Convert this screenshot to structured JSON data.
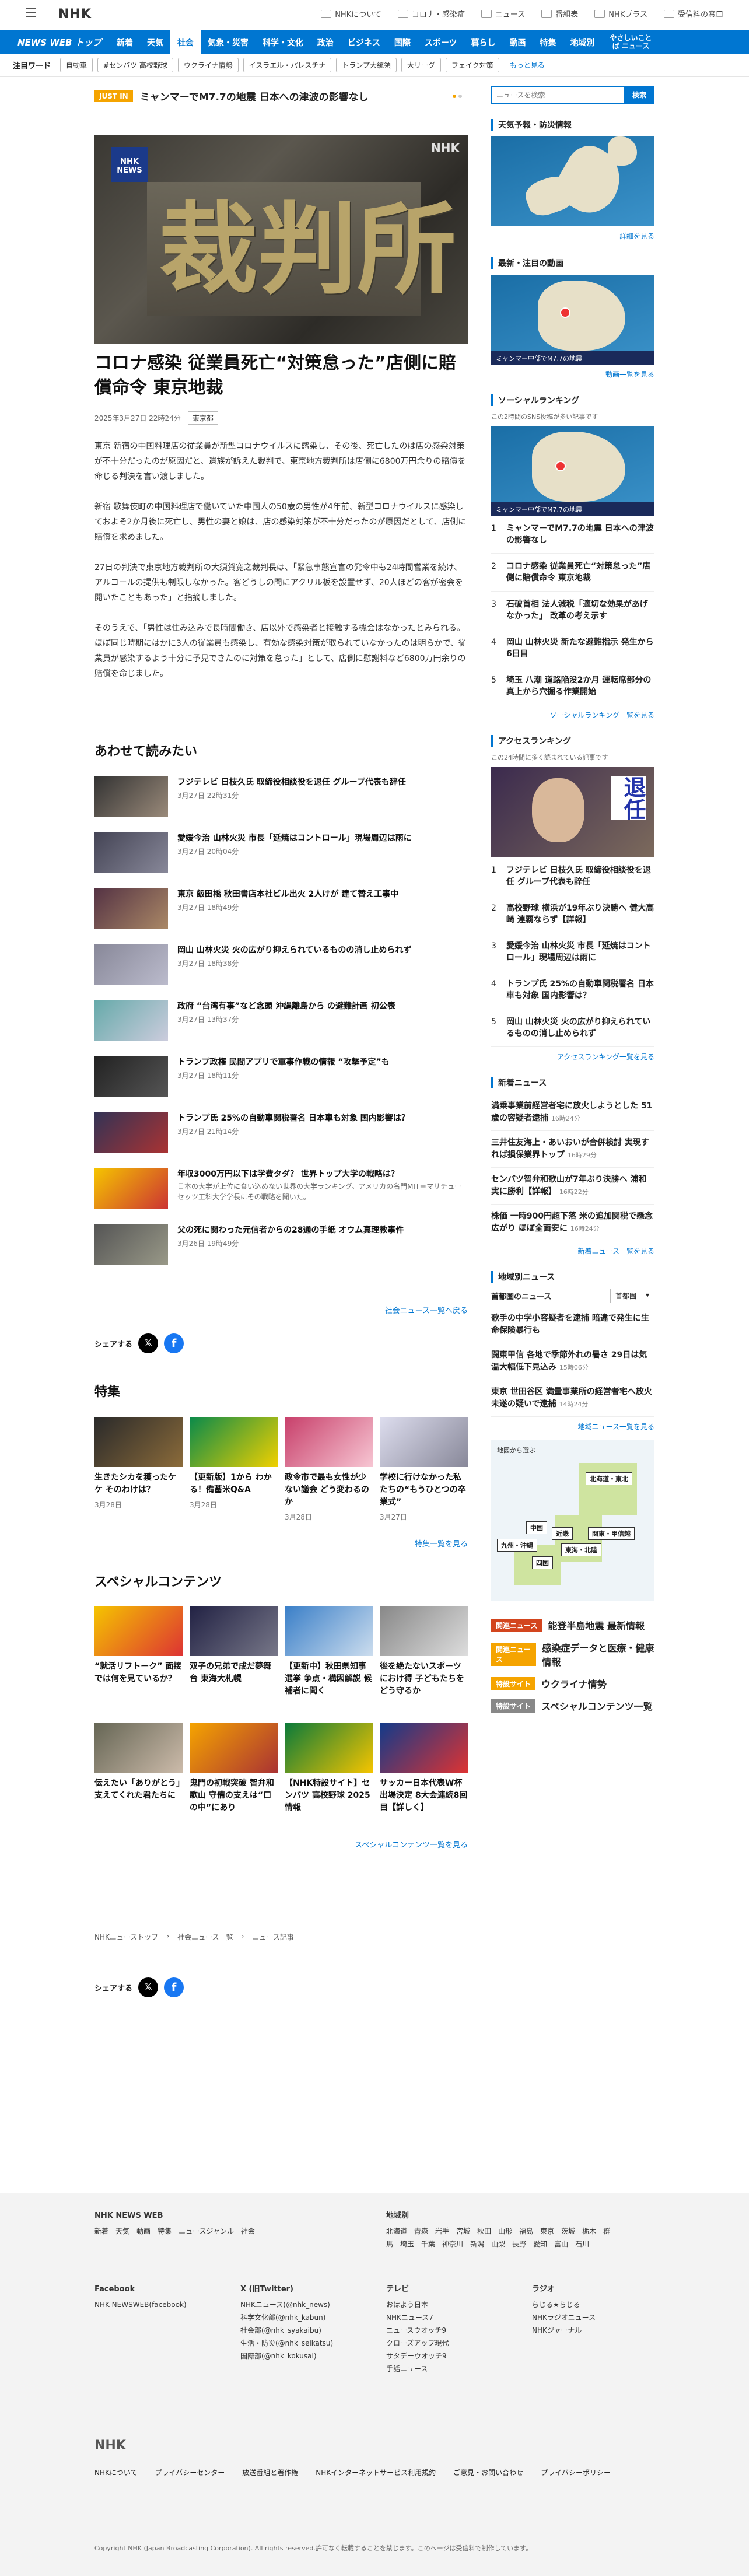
{
  "header": {
    "logo": "NHK",
    "links": [
      "NHKについて",
      "コロナ・感染症",
      "ニュース",
      "番組表",
      "NHKプラス",
      "受信料の窓口"
    ]
  },
  "nav": {
    "brand": "NEWS WEB トップ",
    "items": [
      "新着",
      "天気",
      "社会",
      "気象・災害",
      "科学・文化",
      "政治",
      "ビジネス",
      "国際",
      "スポーツ",
      "暮らし",
      "動画",
      "特集",
      "地域別"
    ],
    "last": "やさしいことば ニュース",
    "active": "社会"
  },
  "keywords": {
    "label": "注目ワード",
    "tags": [
      "自動車",
      "#センバツ 高校野球",
      "ウクライナ情勢",
      "イスラエル・パレスチナ",
      "トランプ大統領",
      "大リーグ",
      "フェイク対策"
    ],
    "more": "もっと見る"
  },
  "breaking": {
    "badge": "JUST IN",
    "text": "ミャンマーでM7.7の地震 日本への津波の影響なし"
  },
  "article": {
    "hero_label": "NHK NEWS",
    "hero_text": "裁判所",
    "watermark": "NHK",
    "title": "コロナ感染 従業員死亡“対策怠った”店側に賠償命令 東京地裁",
    "date": "2025年3月27日 22時24分",
    "category": "東京都",
    "paragraphs": [
      "東京 新宿の中国料理店の従業員が新型コロナウイルスに感染し、その後、死亡したのは店の感染対策が不十分だったのが原因だと、遺族が訴えた裁判で、東京地方裁判所は店側に6800万円余りの賠償を命じる判決を言い渡しました。",
      "新宿 歌舞伎町の中国料理店で働いていた中国人の50歳の男性が4年前、新型コロナウイルスに感染しておよそ2か月後に死亡し、男性の妻と娘は、店の感染対策が不十分だったのが原因だとして、店側に賠償を求めました。",
      "27日の判決で東京地方裁判所の大須賀寛之裁判長は、「緊急事態宣言の発令中も24時間営業を続け、アルコールの提供も制限しなかった。客どうしの間にアクリル板を設置せず、20人ほどの客が密会を開いたこともあった」と指摘しました。",
      "そのうえで、「男性は住み込みで長時間働き、店以外で感染者と接触する機会はなかったとみられる。ほぼ同じ時期にはかに3人の従業員も感染し、有効な感染対策が取られていなかったのは明らかで、従業員が感染するよう十分に予見できたのに対策を怠った」として、店側に慰謝料など6800万円余りの賠償を命じました。"
    ]
  },
  "related": {
    "heading": "あわせて読みたい",
    "items": [
      {
        "title": "フジテレビ 日枝久氏 取締役相談役を退任 グループ代表も辞任",
        "date": "3月27日 22時31分",
        "sub": ""
      },
      {
        "title": "愛媛今治 山林火災 市長「延焼はコントロール」現場周辺は雨に",
        "date": "3月27日 20時04分",
        "sub": ""
      },
      {
        "title": "東京 飯田橋 秋田書店本社ビル出火 2人けが 建て替え工事中",
        "date": "3月27日 18時49分",
        "sub": ""
      },
      {
        "title": "岡山 山林火災 火の広がり抑えられているものの消し止められず",
        "date": "3月27日 18時38分",
        "sub": ""
      },
      {
        "title": "政府 “台湾有事”など念頭 沖縄離島から の避難計画 初公表",
        "date": "3月27日 13時37分",
        "sub": ""
      },
      {
        "title": "トランプ政権 民間アプリで軍事作戦の情報 “攻撃予定”も",
        "date": "3月27日 18時11分",
        "sub": ""
      },
      {
        "title": "トランプ氏 25%の自動車関税署名 日本車も対象 国内影響は？",
        "date": "3月27日 21時14分",
        "sub": ""
      },
      {
        "title": "年収3000万円以下は学費タダ？ 世界トップ大学の戦略は？",
        "date": "",
        "sub": "日本の大学が上位に食い込めない世界の大学ランキング。アメリカの名門MIT＝マサチューセッツ工科大学学長にその戦略を聞いた。"
      },
      {
        "title": "父の死に関わった元信者からの28通の手紙 オウム真理教事件",
        "date": "3月26日 19時49分",
        "sub": ""
      }
    ],
    "more": "社会ニュース一覧へ戻る"
  },
  "share_label": "シェアする",
  "features": {
    "heading": "特集",
    "items": [
      {
        "title": "生きたシカを獲ったケケ そのわけは？",
        "date": "3月28日"
      },
      {
        "title": "【更新版】1から わかる！備蓄米Q&A",
        "date": "3月28日"
      },
      {
        "title": "政令市で最も女性が少ない議会 どう変わるのか",
        "date": "3月28日"
      },
      {
        "title": "学校に行けなかった私たちの“もうひとつの卒業式”",
        "date": "3月27日"
      }
    ],
    "more": "特集一覧を見る"
  },
  "special": {
    "heading": "スペシャルコンテンツ",
    "items": [
      {
        "title": "“就活リフトーク” 面接では何を見ているか？"
      },
      {
        "title": "双子の兄弟で成だ夢舞台 東海大札幌"
      },
      {
        "title": "【更新中】秋田県知事選挙 争点・構図解説 候補者に聞く"
      },
      {
        "title": "後を絶たないスポーツにおけ得 子どもたちをどう守るか"
      },
      {
        "title": "伝えたい「ありがとう」支えてくれた君たちに"
      },
      {
        "title": "鬼門の初戦突破 智弁和歌山 守備の支えは“口の中”にあり"
      },
      {
        "title": "【NHK特設サイト】センバツ 高校野球 2025 情報"
      },
      {
        "title": "サッカー日本代表W杯出場決定 8大会連続8回目【詳しく】"
      }
    ],
    "more": "スペシャルコンテンツ一覧を見る"
  },
  "breadcrumb": [
    "NHKニューストップ",
    "社会ニュース一覧",
    "ニュース記事"
  ],
  "sidebar": {
    "search_placeholder": "ニュースを検索",
    "search_btn": "検索",
    "weather": {
      "heading": "天気予報・防災情報",
      "more": "詳細を見る"
    },
    "video": {
      "heading": "最新・注目の動画",
      "caption": "ミャンマー中部でM7.7の地震",
      "more": "動画一覧を見る"
    },
    "social": {
      "heading": "ソーシャルランキング",
      "note": "この2時間のSNS投稿が多い記事です",
      "items": [
        "ミャンマーでM7.7の地震 日本への津波の影響なし",
        "コロナ感染 従業員死亡“対策怠った”店側に賠償命令 東京地裁",
        "石破首相 法人減税「適切な効果があげなかった」 改革の考え示す",
        "岡山 山林火災 新たな避難指示 発生から6日目",
        "埼玉 八潮 道路陥没2か月 運転席部分の真上から穴掘る作業開始"
      ],
      "more": "ソーシャルランキング一覧を見る"
    },
    "access": {
      "heading": "アクセスランキング",
      "note": "この24時間に多く読まれている記事です",
      "banner": "退任",
      "items": [
        "フジテレビ 日枝久氏 取締役相談役を退任 グループ代表も辞任",
        "高校野球 横浜が19年ぶり決勝へ 健大高崎 連覇ならず【詳報】",
        "愛媛今治 山林火災 市長「延焼はコントロール」現場周辺は雨に",
        "トランプ氏 25%の自動車関税署名 日本車も対象 国内影響は？",
        "岡山 山林火災 火の広がり抑えられているものの消し止められず"
      ],
      "more": "アクセスランキング一覧を見る"
    },
    "latest": {
      "heading": "新着ニュース",
      "items": [
        {
          "t": "満乗事業前経営者宅に放火しようとした 51歳の容疑者逮捕",
          "d": "16時24分"
        },
        {
          "t": "三井住友海上・あいおいが合併検討 実現すれば損保業界トップ",
          "d": "16時29分"
        },
        {
          "t": "センバツ智弁和歌山が7年ぶり決勝へ 浦和実に勝利【詳報】",
          "d": "16時22分"
        },
        {
          "t": "株価 一時900円超下落 米の追加関税で懸念広がり ほぼ全面安に",
          "d": "16時24分"
        }
      ],
      "more": "新着ニュース一覧を見る"
    },
    "regional": {
      "heading": "地域別ニュース",
      "region_label": "首都圏のニュース",
      "select": "首都圏",
      "items": [
        {
          "t": "歌手の中学小容疑者を逮捕 暗違で発生に生命保険暴行も",
          "d": ""
        },
        {
          "t": "闘東甲信 各地で季節外れの暑さ 29日は気温大幅低下見込み",
          "d": "15時06分"
        },
        {
          "t": "東京 世田谷区 満量事業所の経営者宅へ放火未遂の疑いで逮捕",
          "d": "14時24分"
        }
      ],
      "more": "地域ニュース一覧を見る",
      "map_title": "地図から選ぶ",
      "areas": [
        "北海道・東北",
        "関東・甲信越",
        "東海・北陸",
        "近畿",
        "中国",
        "四国",
        "九州・沖縄"
      ]
    },
    "promos": [
      {
        "badge": "関連ニュース",
        "text": "能登半島地震 最新情報",
        "color": "#d3451e"
      },
      {
        "badge": "関連ニュース",
        "text": "感染症データと医療・健康情報",
        "color": "#f5a400"
      },
      {
        "badge": "特設サイト",
        "text": "ウクライナ情勢",
        "color": "#f5a400"
      },
      {
        "badge": "特設サイト",
        "text": "スペシャルコンテンツ一覧",
        "color": "#888"
      }
    ]
  },
  "footer": {
    "cols": [
      {
        "h": "NHK NEWS WEB",
        "items": [
          "新着",
          "天気",
          "動画",
          "特集",
          "ニュースジャンル",
          "社会",
          "気象・災害",
          "科学・文化",
          "政治",
          "ビジネス",
          "国際",
          "スポーツ",
          "暮らし",
          "NHK やさしいことばニュース"
        ]
      },
      {
        "h": "地域別",
        "items": [
          "北海道",
          "青森",
          "岩手",
          "宮城",
          "秋田",
          "山形",
          "福島",
          "東京",
          "茨城",
          "栃木",
          "群馬",
          "埼玉",
          "千葉",
          "神奈川",
          "新潟",
          "山梨",
          "長野",
          "愛知",
          "富山",
          "石川",
          "福井",
          "岐阜",
          "静岡",
          "三重",
          "大阪",
          "京都",
          "兵庫",
          "奈良",
          "滋賀",
          "和歌山",
          "鳥取",
          "島根",
          "岡山",
          "広島",
          "山口",
          "徳島",
          "香川",
          "愛媛",
          "高知",
          "福岡",
          "佐賀",
          "長崎",
          "熊本",
          "大分",
          "宮崎",
          "鹿児島",
          "沖縄",
          "全国"
        ]
      }
    ],
    "social": {
      "facebook": [
        "Facebook",
        "NHK NEWSWEB(facebook)"
      ],
      "x": [
        "X (旧Twitter)",
        "NHKニュース(@nhk_news)",
        "科学文化部(@nhk_kabun)",
        "社会部(@nhk_syakaibu)",
        "生活・防災(@nhk_seikatsu)",
        "国際部(@nhk_kokusai)"
      ],
      "tv": [
        "テレビ",
        "おはよう日本",
        "NHKニュース7",
        "ニュースウオッチ9",
        "クローズアップ現代",
        "サタデーウオッチ9",
        "手話ニュース"
      ],
      "radio": [
        "ラジオ",
        "らじる★らじる",
        "NHKラジオニュース",
        "NHKジャーナル"
      ]
    },
    "bottom_logo": "NHK",
    "links": [
      "NHKについて",
      "プライバシーセンター",
      "放送番組と著作権",
      "NHKインターネットサービス利用規約",
      "ご意見・お問い合わせ",
      "プライバシーポリシー"
    ],
    "copyright": "Copyright NHK (Japan Broadcasting Corporation). All rights reserved.許可なく転載することを禁じます。このページは受信料で制作しています。"
  }
}
